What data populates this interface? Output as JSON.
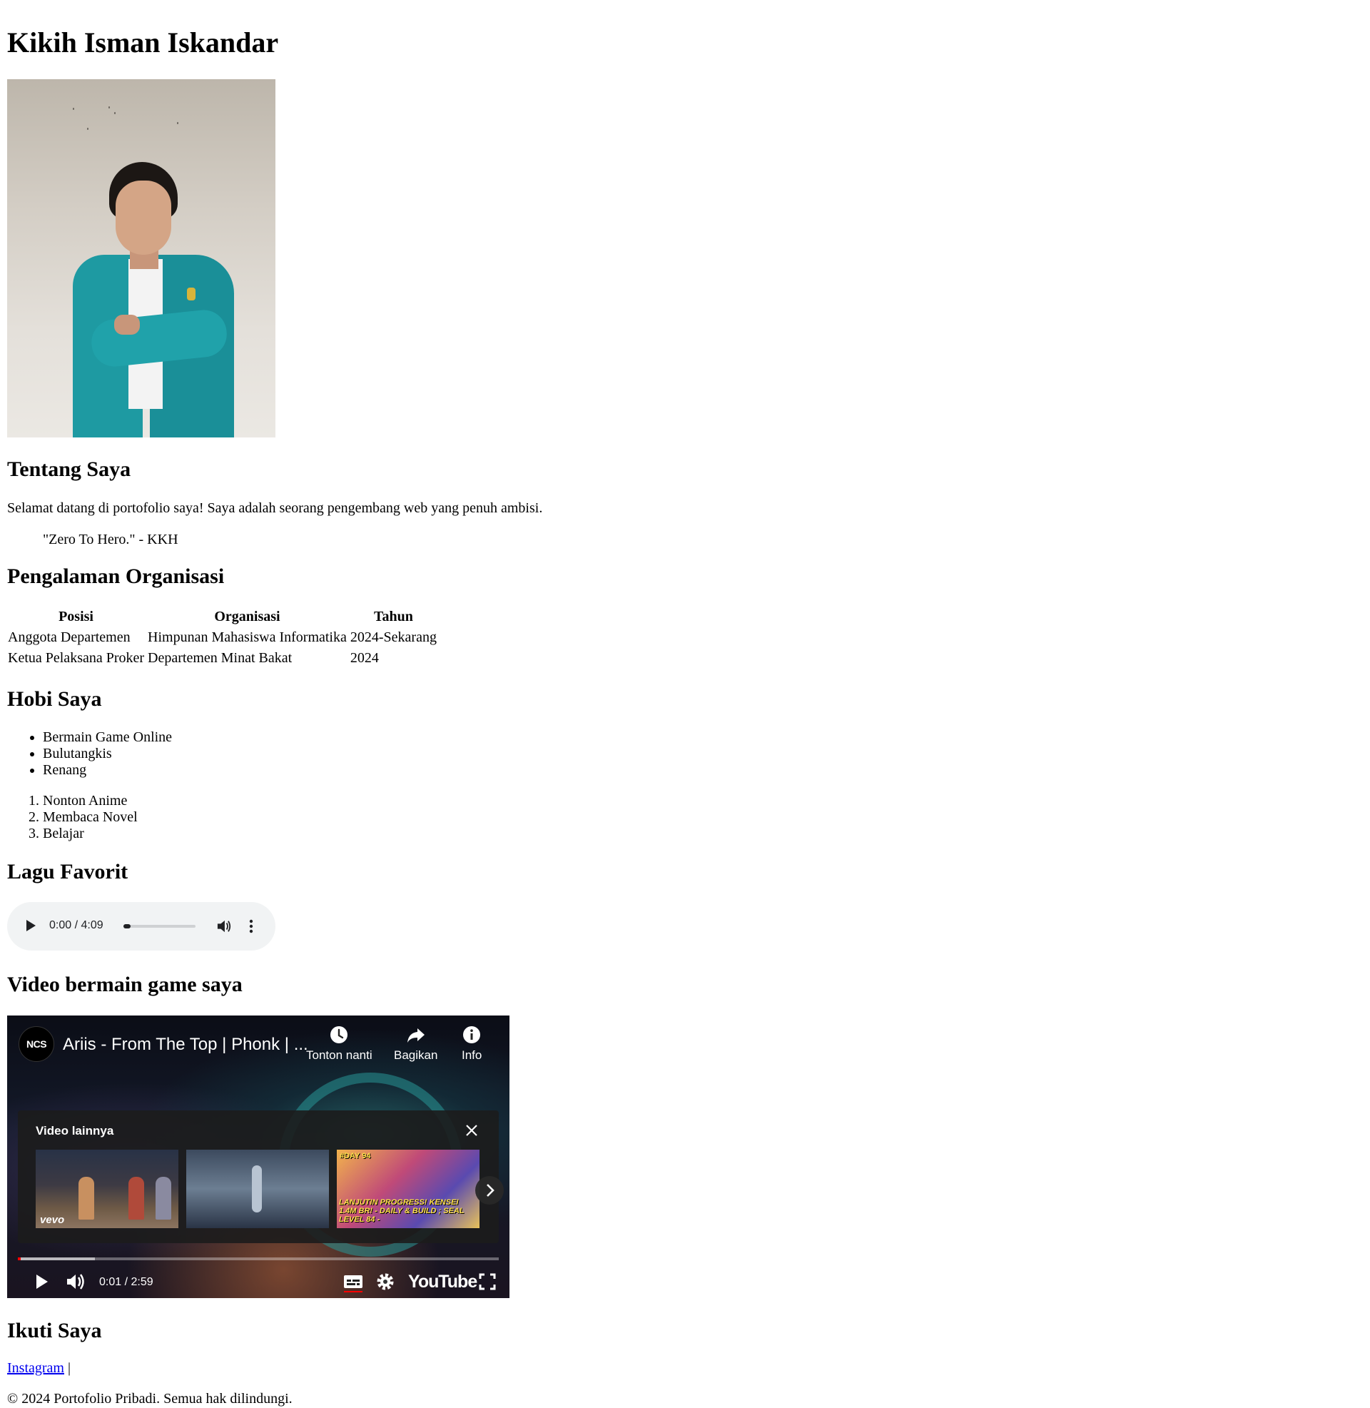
{
  "header": {
    "name": "Kikih Isman Iskandar"
  },
  "about": {
    "heading": "Tentang Saya",
    "text": "Selamat datang di portofolio saya! Saya adalah seorang pengembang web yang penuh ambisi.",
    "quote": "\"Zero To Hero.\" - KKH"
  },
  "organization": {
    "heading": "Pengalaman Organisasi",
    "columns": [
      "Posisi",
      "Organisasi",
      "Tahun"
    ],
    "rows": [
      [
        "Anggota Departemen",
        "Himpunan Mahasiswa Informatika",
        "2024-Sekarang"
      ],
      [
        "Ketua Pelaksana Proker",
        "Departemen Minat Bakat",
        "2024"
      ]
    ]
  },
  "hobbies": {
    "heading": "Hobi Saya",
    "unordered": [
      "Bermain Game Online",
      "Bulutangkis",
      "Renang"
    ],
    "ordered": [
      "Nonton Anime",
      "Membaca Novel",
      "Belajar"
    ]
  },
  "song": {
    "heading": "Lagu Favorit",
    "time": "0:00 / 4:09",
    "progress": 0.0
  },
  "video": {
    "heading": "Video bermain game saya",
    "channel_badge": "NCS",
    "title": "Ariis - From The Top | Phonk | ...",
    "buttons": {
      "watch_later": "Tonton nanti",
      "share": "Bagikan",
      "info": "Info"
    },
    "more_videos_title": "Video lainnya",
    "thumb1_label": "vevo",
    "thumb3_day": "#DAY 94",
    "thumb3_caption": "LANJUTIN PROGRESS! KENSEI 1.4M BR! - DAILY & BUILD ; SEAL LEVEL 84 -",
    "time": "0:01 / 2:59",
    "played_fraction": 0.006,
    "buffered_fraction": 0.16,
    "youtube_label": "YouTube"
  },
  "follow": {
    "heading": "Ikuti Saya",
    "instagram_label": "Instagram",
    "separator": "|"
  },
  "footer": {
    "text": "© 2024 Portofolio Pribadi. Semua hak dilindungi."
  },
  "colors": {
    "link": "#0000ee",
    "progress_red": "#ff0000",
    "audio_bg": "#f1f3f4"
  }
}
